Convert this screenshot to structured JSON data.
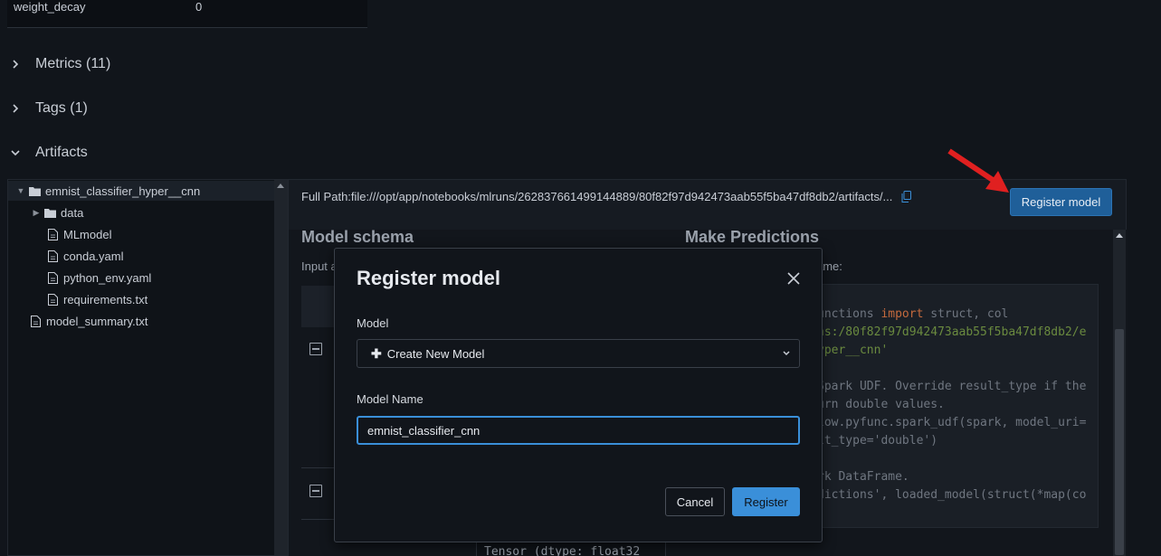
{
  "params": {
    "key": "weight_decay",
    "value": "0"
  },
  "sections": {
    "metrics": "Metrics (11)",
    "tags": "Tags (1)",
    "artifacts": "Artifacts"
  },
  "tree": {
    "root": "emnist_classifier_hyper__cnn",
    "items": [
      "data",
      "MLmodel",
      "conda.yaml",
      "python_env.yaml",
      "requirements.txt",
      "model_summary.txt"
    ]
  },
  "artifact_panel": {
    "full_path": "Full Path:file:///opt/app/notebooks/mlruns/262837661499144889/80f82f97d942473aab55f5ba47df8db2/artifacts/...",
    "register_button": "Register model",
    "model_schema_title": "Model schema",
    "input_label": "Input a",
    "make_predictions_title": "Make Predictions",
    "predictions_sub": "ame:",
    "code_lines": [
      {
        "a": "unctions ",
        "kw": "import",
        "b": " struct, col"
      },
      {
        "str": "ns:/80f82f97d942473aab55f5ba47df8db2/e"
      },
      {
        "str": "yper__cnn'"
      },
      {
        "a": ""
      },
      {
        "a": "Spark UDF. Override result_type if the"
      },
      {
        "a": "urn double values."
      },
      {
        "a": "low.pyfunc.spark_udf(spark, model_uri="
      },
      {
        "a": "lt_type='double')"
      },
      {
        "a": ""
      },
      {
        "a": "rk DataFrame."
      },
      {
        "a": "dictions', loaded_model(struct(*map(co"
      }
    ],
    "tensor_text": "Tensor (dtype: float32"
  },
  "modal": {
    "title": "Register model",
    "model_label": "Model",
    "model_selected": "Create New Model",
    "model_name_label": "Model Name",
    "model_name_value": "emnist_classifier_cnn",
    "cancel": "Cancel",
    "register": "Register"
  },
  "colors": {
    "background": "#11151b",
    "primary": "#3a8fd9",
    "annotation_arrow": "#e02020"
  }
}
